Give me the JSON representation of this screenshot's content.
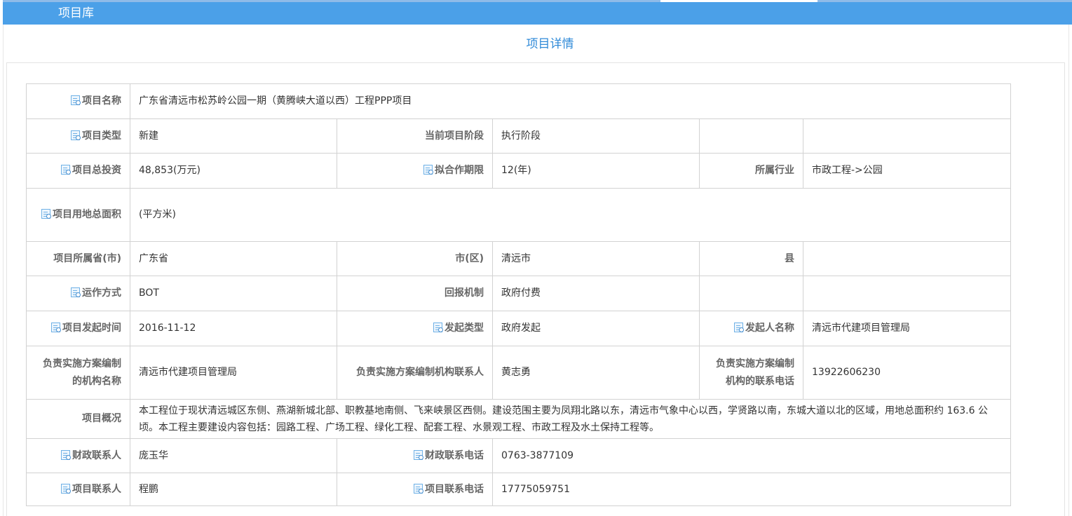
{
  "header": {
    "title": "项目库"
  },
  "page": {
    "heading": "项目详情"
  },
  "icons": {
    "label_icon": "document-search-icon"
  },
  "details": {
    "project_name_label": "项目名称",
    "project_name": "广东省清远市松苏岭公园一期（黄腾峡大道以西）工程PPP项目",
    "project_type_label": "项目类型",
    "project_type": "新建",
    "current_stage_label": "当前项目阶段",
    "current_stage": "执行阶段",
    "total_investment_label": "项目总投资",
    "total_investment": "48,853(万元)",
    "cooperation_period_label": "拟合作期限",
    "cooperation_period": "12(年)",
    "industry_label": "所属行业",
    "industry": "市政工程->公园",
    "land_area_label": "项目用地总面积",
    "land_area": "(平方米)",
    "province_label": "项目所属省(市)",
    "province": "广东省",
    "city_label": "市(区)",
    "city": "清远市",
    "county_label": "县",
    "county": "",
    "operation_mode_label": "运作方式",
    "operation_mode": "BOT",
    "return_mechanism_label": "回报机制",
    "return_mechanism": "政府付费",
    "launch_time_label": "项目发起时间",
    "launch_time": "2016-11-12",
    "launch_type_label": "发起类型",
    "launch_type": "政府发起",
    "initiator_label": "发起人名称",
    "initiator": "清远市代建项目管理局",
    "plan_org_label": "负责实施方案编制的机构名称",
    "plan_org": "清远市代建项目管理局",
    "plan_contact_label": "负责实施方案编制机构联系人",
    "plan_contact": "黄志勇",
    "plan_phone_label": "负责实施方案编制机构的联系电话",
    "plan_phone": "13922606230",
    "overview_label": "项目概况",
    "overview": "本工程位于现状清远城区东侧、燕湖新城北部、职教基地南侧、飞来峡景区西侧。建设范围主要为凤翔北路以东，清远市气象中心以西，学贤路以南，东城大道以北的区域，用地总面积约 163.6 公顷。本工程主要建设内容包括：园路工程、广场工程、绿化工程、配套工程、水景观工程、市政工程及水土保持工程等。",
    "finance_contact_label": "财政联系人",
    "finance_contact": "庞玉华",
    "finance_phone_label": "财政联系电话",
    "finance_phone": "0763-3877109",
    "project_contact_label": "项目联系人",
    "project_contact": "程鹏",
    "project_phone_label": "项目联系电话",
    "project_phone": "17775059751"
  }
}
